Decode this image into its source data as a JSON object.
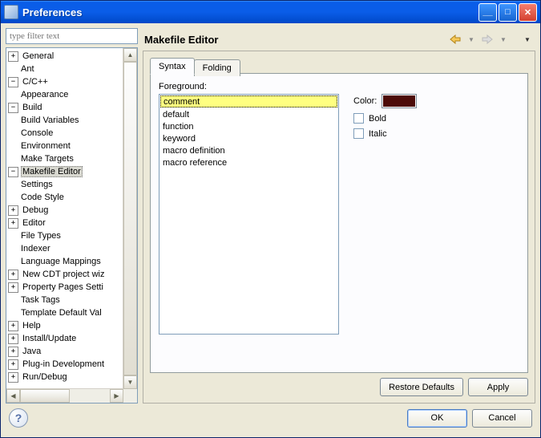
{
  "window": {
    "title": "Preferences"
  },
  "filter": {
    "placeholder": "type filter text"
  },
  "tree": [
    {
      "level": 0,
      "expand": "+",
      "label": "General"
    },
    {
      "level": 0,
      "expand": " ",
      "label": "Ant"
    },
    {
      "level": 0,
      "expand": "-",
      "label": "C/C++"
    },
    {
      "level": 1,
      "expand": " ",
      "label": "Appearance"
    },
    {
      "level": 1,
      "expand": "-",
      "label": "Build"
    },
    {
      "level": 2,
      "expand": " ",
      "label": "Build Variables"
    },
    {
      "level": 2,
      "expand": " ",
      "label": "Console"
    },
    {
      "level": 2,
      "expand": " ",
      "label": "Environment"
    },
    {
      "level": 2,
      "expand": " ",
      "label": "Make Targets"
    },
    {
      "level": 2,
      "expand": "-",
      "label": "Makefile Editor",
      "sel": true
    },
    {
      "level": 3,
      "expand": " ",
      "label": "Settings"
    },
    {
      "level": 1,
      "expand": " ",
      "label": "Code Style"
    },
    {
      "level": 1,
      "expand": "+",
      "label": "Debug"
    },
    {
      "level": 1,
      "expand": "+",
      "label": "Editor"
    },
    {
      "level": 1,
      "expand": " ",
      "label": "File Types"
    },
    {
      "level": 1,
      "expand": " ",
      "label": "Indexer"
    },
    {
      "level": 1,
      "expand": " ",
      "label": "Language Mappings"
    },
    {
      "level": 1,
      "expand": "+",
      "label": "New CDT project wiz"
    },
    {
      "level": 1,
      "expand": "+",
      "label": "Property Pages Setti"
    },
    {
      "level": 1,
      "expand": " ",
      "label": "Task Tags"
    },
    {
      "level": 1,
      "expand": " ",
      "label": "Template Default Val"
    },
    {
      "level": 0,
      "expand": "+",
      "label": "Help"
    },
    {
      "level": 0,
      "expand": "+",
      "label": "Install/Update"
    },
    {
      "level": 0,
      "expand": "+",
      "label": "Java"
    },
    {
      "level": 0,
      "expand": "+",
      "label": "Plug-in Development"
    },
    {
      "level": 0,
      "expand": "+",
      "label": "Run/Debug"
    }
  ],
  "page": {
    "title": "Makefile Editor",
    "tabs": {
      "syntax": "Syntax",
      "folding": "Folding"
    },
    "foreground_label": "Foreground:",
    "items": [
      "comment",
      "default",
      "function",
      "keyword",
      "macro definition",
      "macro reference"
    ],
    "color_label": "Color:",
    "color_value": "#4d0c09",
    "bold_label": "Bold",
    "italic_label": "Italic"
  },
  "buttons": {
    "restore": "Restore Defaults",
    "apply": "Apply",
    "ok": "OK",
    "cancel": "Cancel"
  }
}
